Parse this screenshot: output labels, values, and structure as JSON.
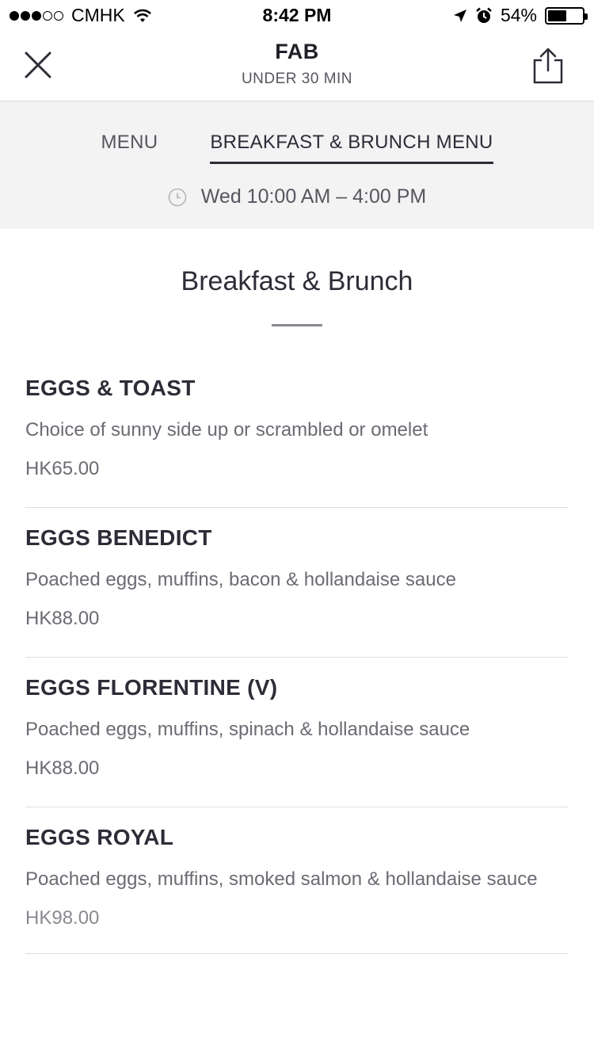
{
  "status_bar": {
    "carrier": "CMHK",
    "time": "8:42 PM",
    "battery_percent": "54%",
    "battery_level": 0.54,
    "signal_bars_filled": 3,
    "signal_bars_total": 5
  },
  "nav": {
    "title": "FAB",
    "subtitle": "UNDER 30 MIN"
  },
  "menu_tabs": [
    {
      "label": "MENU",
      "active": false
    },
    {
      "label": "BREAKFAST & BRUNCH MENU",
      "active": true
    }
  ],
  "hours": "Wed 10:00 AM – 4:00 PM",
  "section": {
    "title": "Breakfast & Brunch"
  },
  "items": [
    {
      "name": "EGGS & TOAST",
      "description": "Choice of sunny side up or scrambled or omelet",
      "price": "HK65.00"
    },
    {
      "name": "EGGS BENEDICT",
      "description": "Poached eggs, muffins, bacon & hollandaise sauce",
      "price": "HK88.00"
    },
    {
      "name": "EGGS FLORENTINE (V)",
      "description": "Poached eggs, muffins, spinach & hollandaise sauce",
      "price": "HK88.00"
    },
    {
      "name": "EGGS ROYAL",
      "description": "Poached eggs, muffins, smoked salmon & hollandaise sauce",
      "price": "HK98.00"
    }
  ],
  "icons": {
    "close": "close-icon",
    "share": "share-icon",
    "clock": "clock-icon",
    "wifi": "wifi-icon",
    "location": "location-arrow-icon",
    "alarm": "alarm-icon"
  },
  "colors": {
    "text_primary": "#2d2d38",
    "text_secondary": "#6b6b73",
    "header_bg": "#f3f3f4"
  }
}
